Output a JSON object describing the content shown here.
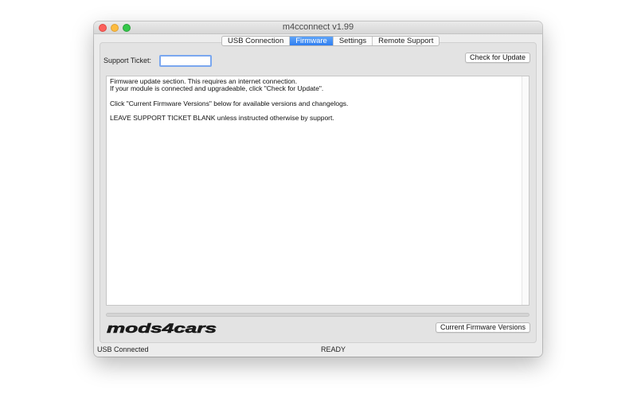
{
  "window": {
    "title": "m4cconnect v1.99"
  },
  "tabs": [
    {
      "label": "USB Connection",
      "active": false
    },
    {
      "label": "Firmware",
      "active": true
    },
    {
      "label": "Settings",
      "active": false
    },
    {
      "label": "Remote Support",
      "active": false
    }
  ],
  "firmware": {
    "support_ticket_label": "Support Ticket:",
    "support_ticket_value": "",
    "check_update_label": "Check for Update",
    "current_versions_label": "Current Firmware Versions",
    "info_lines": [
      "Firmware update section. This requires an internet connection.",
      "If your module is connected and upgradeable, click \"Check for Update\".",
      "",
      "Click \"Current Firmware Versions\" below for available versions and changelogs.",
      "",
      "LEAVE SUPPORT TICKET BLANK unless instructed otherwise by support."
    ]
  },
  "logo": {
    "text": "mods4cars"
  },
  "status": {
    "connection": "USB Connected",
    "state": "READY"
  },
  "colors": {
    "accent": "#2f7ef1",
    "close": "#fc605c",
    "minimize": "#fdbc40",
    "maximize": "#34c84a"
  }
}
